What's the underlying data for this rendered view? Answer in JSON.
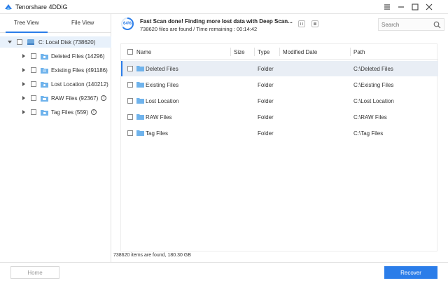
{
  "app": {
    "title": "Tenorshare 4DDiG"
  },
  "colors": {
    "accent": "#2b7de9",
    "folder": "#6fb3ec",
    "selected_row": "#e9eef5"
  },
  "view_tabs": {
    "tree": "Tree View",
    "file": "File View"
  },
  "tree": {
    "root": {
      "label": "C: Local Disk (738620)"
    },
    "items": [
      {
        "label": "Deleted Files (14296)",
        "icon": "trash-folder-icon"
      },
      {
        "label": "Existing Files (491186)",
        "icon": "doc-folder-icon"
      },
      {
        "label": "Lost Location (140212)",
        "icon": "location-folder-icon"
      },
      {
        "label": "RAW Files (92367)",
        "icon": "raw-folder-icon"
      },
      {
        "label": "Tag Files (559)",
        "icon": "tag-folder-icon"
      }
    ]
  },
  "scan": {
    "percent_label": "64%",
    "percent": 64,
    "title": "Fast Scan done! Finding more lost data with Deep Scan...",
    "subtitle": "738620 files are found  /  Time remaining : 00:14:42"
  },
  "search": {
    "placeholder": "Search"
  },
  "table": {
    "headers": {
      "name": "Name",
      "size": "Size",
      "type": "Type",
      "modified": "Modified Date",
      "path": "Path"
    },
    "rows": [
      {
        "name": "Deleted Files",
        "size": "",
        "type": "Folder",
        "modified": "",
        "path": "C:\\Deleted Files"
      },
      {
        "name": "Existing Files",
        "size": "",
        "type": "Folder",
        "modified": "",
        "path": "C:\\Existing Files"
      },
      {
        "name": "Lost Location",
        "size": "",
        "type": "Folder",
        "modified": "",
        "path": "C:\\Lost Location"
      },
      {
        "name": "RAW Files",
        "size": "",
        "type": "Folder",
        "modified": "",
        "path": "C:\\RAW Files"
      },
      {
        "name": "Tag Files",
        "size": "",
        "type": "Folder",
        "modified": "",
        "path": "C:\\Tag Files"
      }
    ]
  },
  "status": {
    "text": "738620 items are found, 180.30 GB"
  },
  "footer": {
    "home_label": "Home",
    "recover_label": "Recover"
  }
}
